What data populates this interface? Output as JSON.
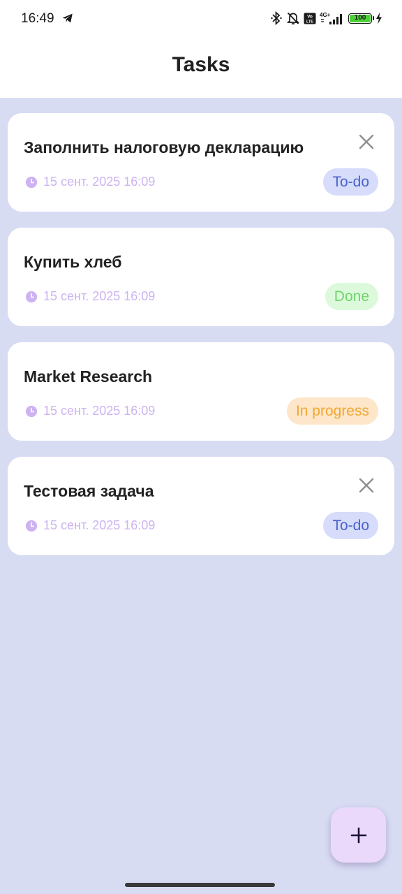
{
  "status_bar": {
    "time": "16:49",
    "battery": "100",
    "network": "4G+",
    "volte": "Vo LTE",
    "icons": [
      "telegram-icon",
      "bluetooth-icon",
      "bell-off-icon",
      "volte-icon",
      "signal-icon",
      "battery-icon",
      "charging-icon"
    ]
  },
  "header": {
    "title": "Tasks"
  },
  "tasks": [
    {
      "title": "Заполнить налоговую декларацию",
      "date": "15 сент. 2025 16:09",
      "status": "To-do"
    },
    {
      "title": "Купить хлеб",
      "date": "15 сент. 2025 16:09",
      "status": "Done"
    },
    {
      "title": "Market Research",
      "date": "15 сент. 2025 16:09",
      "status": "In progress"
    },
    {
      "title": "Тестовая задача",
      "date": "15 сент. 2025 16:09",
      "status": "To-do"
    }
  ],
  "fab": {
    "icon": "plus-icon"
  },
  "colors": {
    "background": "#d8dcf3",
    "card": "#ffffff",
    "date_text": "#cdb3f2",
    "todo_bg": "#d6dcfa",
    "todo_text": "#4a63cf",
    "done_bg": "#dcfadb",
    "done_text": "#6fd46a",
    "progress_bg": "#fde6c9",
    "progress_text": "#f1a830",
    "fab_bg": "#ebd9fb"
  }
}
